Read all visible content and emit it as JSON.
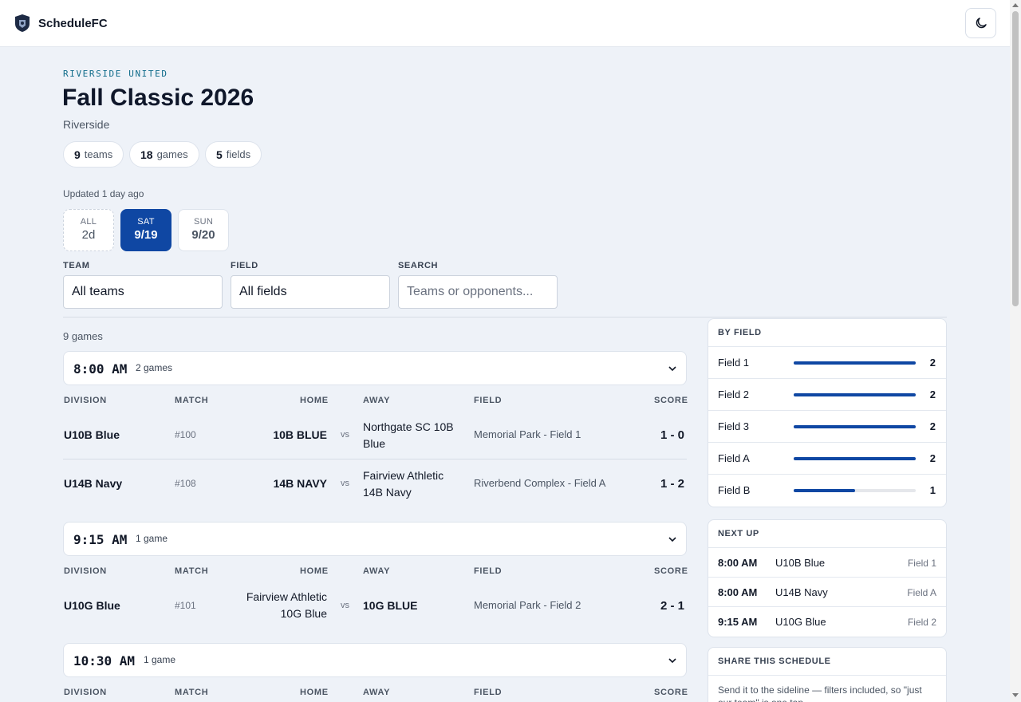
{
  "app": {
    "brand": "ScheduleFC"
  },
  "header": {
    "org": "RIVERSIDE UNITED",
    "title": "Fall Classic 2026",
    "location": "Riverside",
    "stats": [
      {
        "value": "9",
        "label": "teams"
      },
      {
        "value": "18",
        "label": "games"
      },
      {
        "value": "5",
        "label": "fields"
      }
    ],
    "updated": "Updated 1 day ago"
  },
  "days": [
    {
      "label": "ALL",
      "value": "2d",
      "active": false
    },
    {
      "label": "SAT",
      "value": "9/19",
      "active": true
    },
    {
      "label": "SUN",
      "value": "9/20",
      "active": false
    }
  ],
  "filters": {
    "team": {
      "label": "TEAM",
      "value": "All teams"
    },
    "field": {
      "label": "FIELD",
      "value": "All fields"
    },
    "search": {
      "label": "SEARCH",
      "placeholder": "Teams or opponents..."
    }
  },
  "schedule": {
    "count_label": "9 games",
    "columns": [
      "DIVISION",
      "MATCH",
      "HOME",
      "AWAY",
      "FIELD",
      "SCORE"
    ],
    "slots": [
      {
        "time": "8:00 AM",
        "count": "2 games",
        "games": [
          {
            "division": "U10B Blue",
            "match": "#100",
            "home_l1": "10B BLUE",
            "home_l2": "",
            "vs": "vs",
            "away_l1": "Northgate SC 10B",
            "away_l2": "Blue",
            "field": "Memorial Park - Field 1",
            "score": "1 - 0"
          },
          {
            "division": "U14B Navy",
            "match": "#108",
            "home_l1": "14B NAVY",
            "home_l2": "",
            "vs": "vs",
            "away_l1": "Fairview Athletic",
            "away_l2": "14B Navy",
            "field": "Riverbend Complex - Field A",
            "score": "1 - 2"
          }
        ]
      },
      {
        "time": "9:15 AM",
        "count": "1 game",
        "games": [
          {
            "division": "U10G Blue",
            "match": "#101",
            "home_l1": "Fairview Athletic",
            "home_l2": "10G Blue",
            "vs": "vs",
            "away_l1": "10G BLUE",
            "away_l2": "",
            "field": "Memorial Park - Field 2",
            "score": "2 - 1"
          }
        ]
      },
      {
        "time": "10:30 AM",
        "count": "1 game",
        "games": []
      }
    ]
  },
  "by_field": {
    "title": "BY FIELD",
    "max": 2,
    "rows": [
      {
        "name": "Field 1",
        "count": 2
      },
      {
        "name": "Field 2",
        "count": 2
      },
      {
        "name": "Field 3",
        "count": 2
      },
      {
        "name": "Field A",
        "count": 2
      },
      {
        "name": "Field B",
        "count": 1
      }
    ]
  },
  "next_up": {
    "title": "NEXT UP",
    "rows": [
      {
        "time": "8:00 AM",
        "division": "U10B Blue",
        "field": "Field 1"
      },
      {
        "time": "8:00 AM",
        "division": "U14B Navy",
        "field": "Field A"
      },
      {
        "time": "9:15 AM",
        "division": "U10G Blue",
        "field": "Field 2"
      }
    ]
  },
  "share": {
    "title": "SHARE THIS SCHEDULE",
    "text": "Send it to the sideline — filters included, so \"just our team\" is one tap."
  },
  "colors": {
    "accent": "#0f47a3",
    "kicker": "#0f6b8a",
    "background": "#eef2f8"
  },
  "icons": {
    "logo": "shield-crest-icon",
    "theme": "moon-icon",
    "chevron": "chevron-down-icon"
  }
}
